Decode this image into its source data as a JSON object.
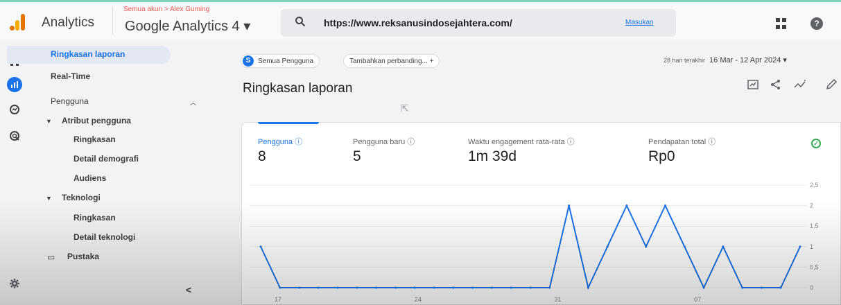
{
  "header": {
    "app_title": "Analytics",
    "breadcrumb": "Semua akun > Alex Guming",
    "property": "Google Analytics 4 ▾",
    "search_text": "https://www.reksanusindosejahtera.com/",
    "search_action": "Masukan"
  },
  "sidebar": {
    "items": [
      {
        "label": "Ringkasan laporan"
      },
      {
        "label": "Real-Time"
      },
      {
        "label": "Pengguna"
      },
      {
        "label": "Atribut pengguna"
      },
      {
        "label": "Ringkasan"
      },
      {
        "label": "Detail demografi"
      },
      {
        "label": "Audiens"
      },
      {
        "label": "Teknologi"
      },
      {
        "label": "Ringkasan"
      },
      {
        "label": "Detail teknologi"
      },
      {
        "label": "Pustaka"
      }
    ],
    "collapse_glyph": "<"
  },
  "toolbar": {
    "segment_badge": "S",
    "segment_label": "Semua Pengguna",
    "compare_label": "Tambahkan perbanding...  +",
    "date_label": "28 hari terakhir",
    "date_value": "16 Mar - 12 Apr 2024  ▾"
  },
  "main": {
    "title": "Ringkasan laporan"
  },
  "metrics": [
    {
      "label": "Pengguna ⓘ",
      "value": "8"
    },
    {
      "label": "Pengguna baru ⓘ",
      "value": "5"
    },
    {
      "label": "Waktu engagement rata-rata ⓘ",
      "value": "1m 39d"
    },
    {
      "label": "Pendapatan total ⓘ",
      "value": "Rp0"
    }
  ],
  "colors": {
    "accent": "#1a73e8",
    "success": "#34a853",
    "logo_orange": "#e37400",
    "logo_yellow": "#f9ab00"
  },
  "chart_data": {
    "type": "line",
    "x": [
      17,
      18,
      19,
      20,
      21,
      22,
      23,
      24,
      25,
      26,
      27,
      28,
      29,
      30,
      31,
      1,
      2,
      3,
      4,
      5,
      6,
      7,
      8,
      9,
      10,
      11,
      12
    ],
    "xticks": [
      {
        "pos": 0,
        "label": "17"
      },
      {
        "pos": 7,
        "label": "24"
      },
      {
        "pos": 14,
        "label": "31"
      },
      {
        "pos": 21,
        "label": "07"
      }
    ],
    "series": [
      {
        "values": [
          1,
          0,
          0,
          0,
          0,
          0,
          0,
          0,
          0,
          0,
          0,
          0,
          0,
          0,
          0,
          0,
          2,
          0,
          1,
          2,
          1,
          2,
          1,
          0,
          1,
          0,
          0,
          0,
          1
        ]
      }
    ],
    "yticks": [
      "2,5",
      "2",
      "1,5",
      "1",
      "0,5",
      "0"
    ],
    "ylim": [
      0,
      2.5
    ],
    "grid": true
  }
}
